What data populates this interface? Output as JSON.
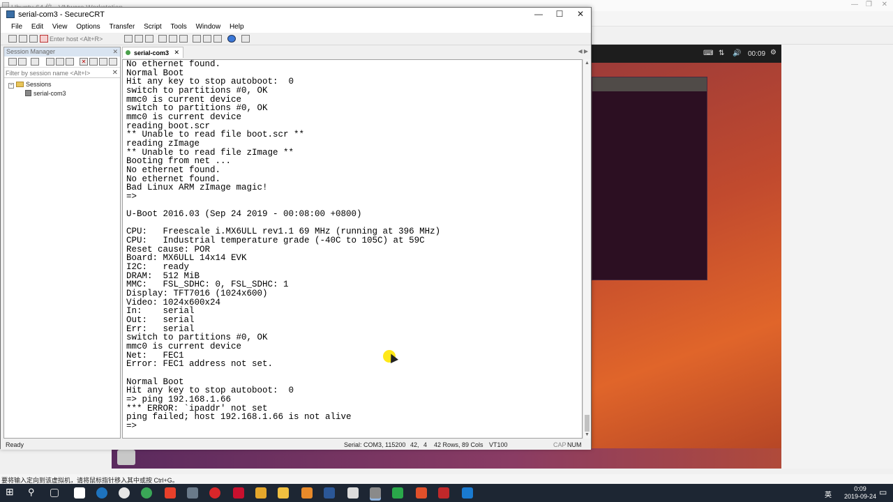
{
  "vm_window": {
    "title": "Ubuntu 64 位 - VMware Workstation",
    "status_message": "要将输入定向到该虚拟机，请将鼠标指针移入其中或按 Ctrl+G。"
  },
  "ubuntu": {
    "clock": "00:09"
  },
  "app": {
    "title": "serial-com3 - SecureCRT",
    "menu": [
      "File",
      "Edit",
      "View",
      "Options",
      "Transfer",
      "Script",
      "Tools",
      "Window",
      "Help"
    ],
    "host_placeholder": "Enter host <Alt+R>"
  },
  "session_manager": {
    "title": "Session Manager",
    "filter_placeholder": "Filter by session name <Alt+I>",
    "tree": {
      "root": "Sessions",
      "child": "serial-com3"
    }
  },
  "tab": {
    "label": "serial-com3"
  },
  "terminal": {
    "text": "No ethernet found.\nNormal Boot\nHit any key to stop autoboot:  0\nswitch to partitions #0, OK\nmmc0 is current device\nswitch to partitions #0, OK\nmmc0 is current device\nreading boot.scr\n** Unable to read file boot.scr **\nreading zImage\n** Unable to read file zImage **\nBooting from net ...\nNo ethernet found.\nNo ethernet found.\nBad Linux ARM zImage magic!\n=>\n\nU-Boot 2016.03 (Sep 24 2019 - 00:08:00 +0800)\n\nCPU:   Freescale i.MX6ULL rev1.1 69 MHz (running at 396 MHz)\nCPU:   Industrial temperature grade (-40C to 105C) at 59C\nReset cause: POR\nBoard: MX6ULL 14x14 EVK\nI2C:   ready\nDRAM:  512 MiB\nMMC:   FSL_SDHC: 0, FSL_SDHC: 1\nDisplay: TFT7016 (1024x600)\nVideo: 1024x600x24\nIn:    serial\nOut:   serial\nErr:   serial\nswitch to partitions #0, OK\nmmc0 is current device\nNet:   FEC1\nError: FEC1 address not set.\n\nNormal Boot\nHit any key to stop autoboot:  0\n=> ping 192.168.1.66\n*** ERROR: `ipaddr' not set\nping failed; host 192.168.1.66 is not alive\n=>"
  },
  "status_bar": {
    "ready": "Ready",
    "connection": "Serial: COM3, 115200",
    "row": "42,",
    "col": "4",
    "size": "42 Rows, 89 Cols",
    "emulation": "VT100",
    "cap": "CAP",
    "num": "NUM"
  },
  "taskbar": {
    "ime": "英",
    "time": "0:09",
    "date": "2019-09-24"
  }
}
